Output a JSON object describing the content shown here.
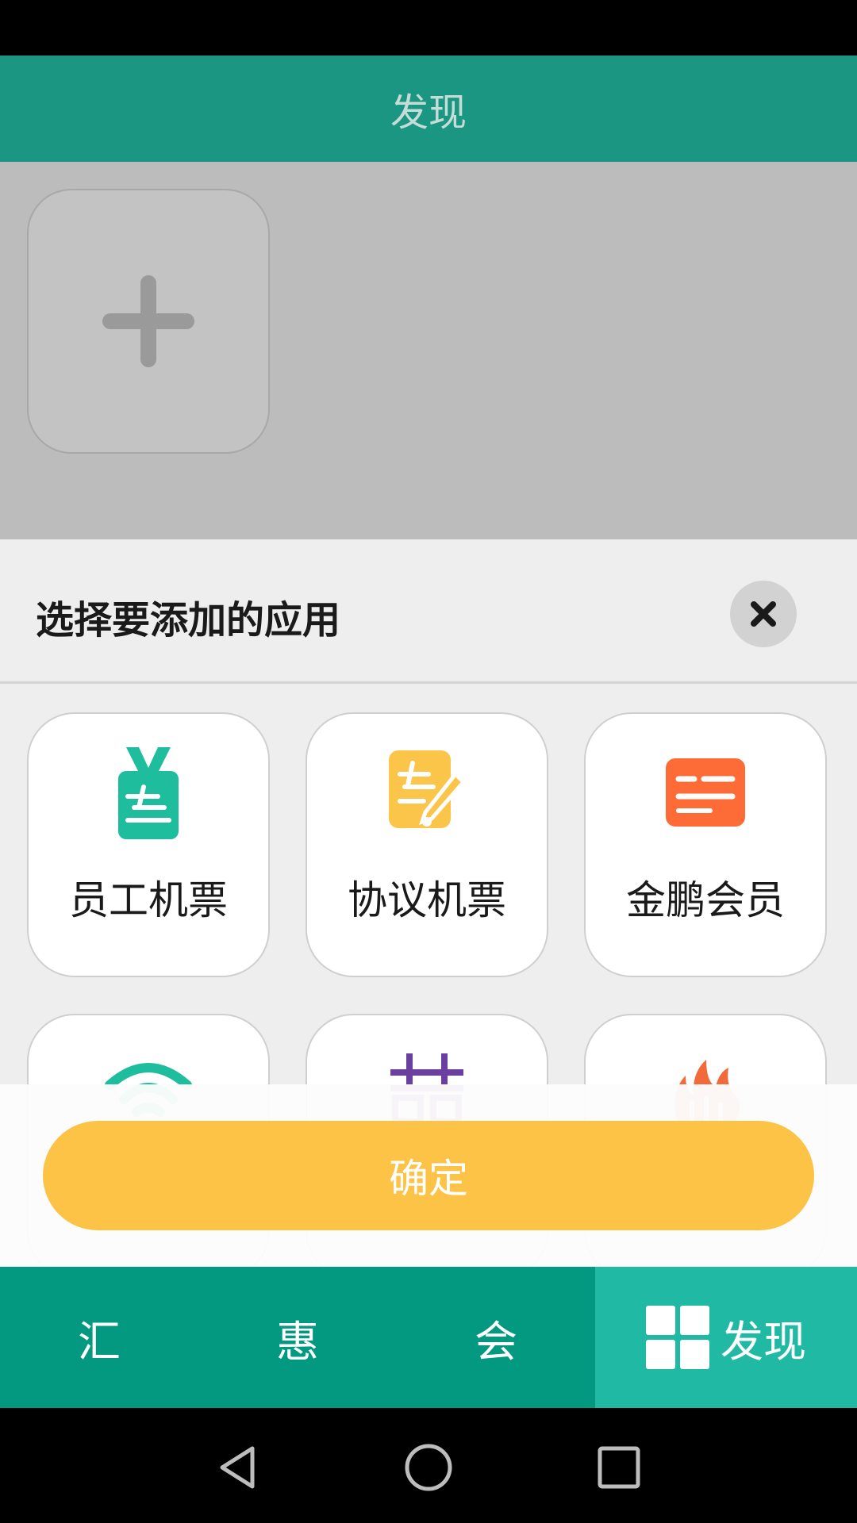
{
  "header": {
    "title": "发现"
  },
  "sheet": {
    "title": "选择要添加的应用",
    "apps": [
      {
        "label": "员工机票",
        "icon": "employee-ticket-icon",
        "color": "#1dbd9e"
      },
      {
        "label": "协议机票",
        "icon": "agreement-ticket-icon",
        "color": "#fbc54a"
      },
      {
        "label": "金鹏会员",
        "icon": "membership-card-icon",
        "color": "#fd6b36"
      },
      {
        "label": "",
        "icon": "wifi-icon",
        "color": "#1dbd9e"
      },
      {
        "label": "",
        "icon": "purple-app-icon",
        "color": "#6a3fa0"
      },
      {
        "label": "",
        "icon": "flame-icon",
        "color": "#f26a3a"
      }
    ]
  },
  "confirm": {
    "label": "确定"
  },
  "nav": {
    "items": [
      {
        "label": "汇"
      },
      {
        "label": "惠"
      },
      {
        "label": "会"
      },
      {
        "label": "发现"
      }
    ]
  },
  "colors": {
    "primary": "#1a9683",
    "nav_bg": "#039981",
    "nav_active": "#20b9a3",
    "accent": "#fdc346"
  }
}
